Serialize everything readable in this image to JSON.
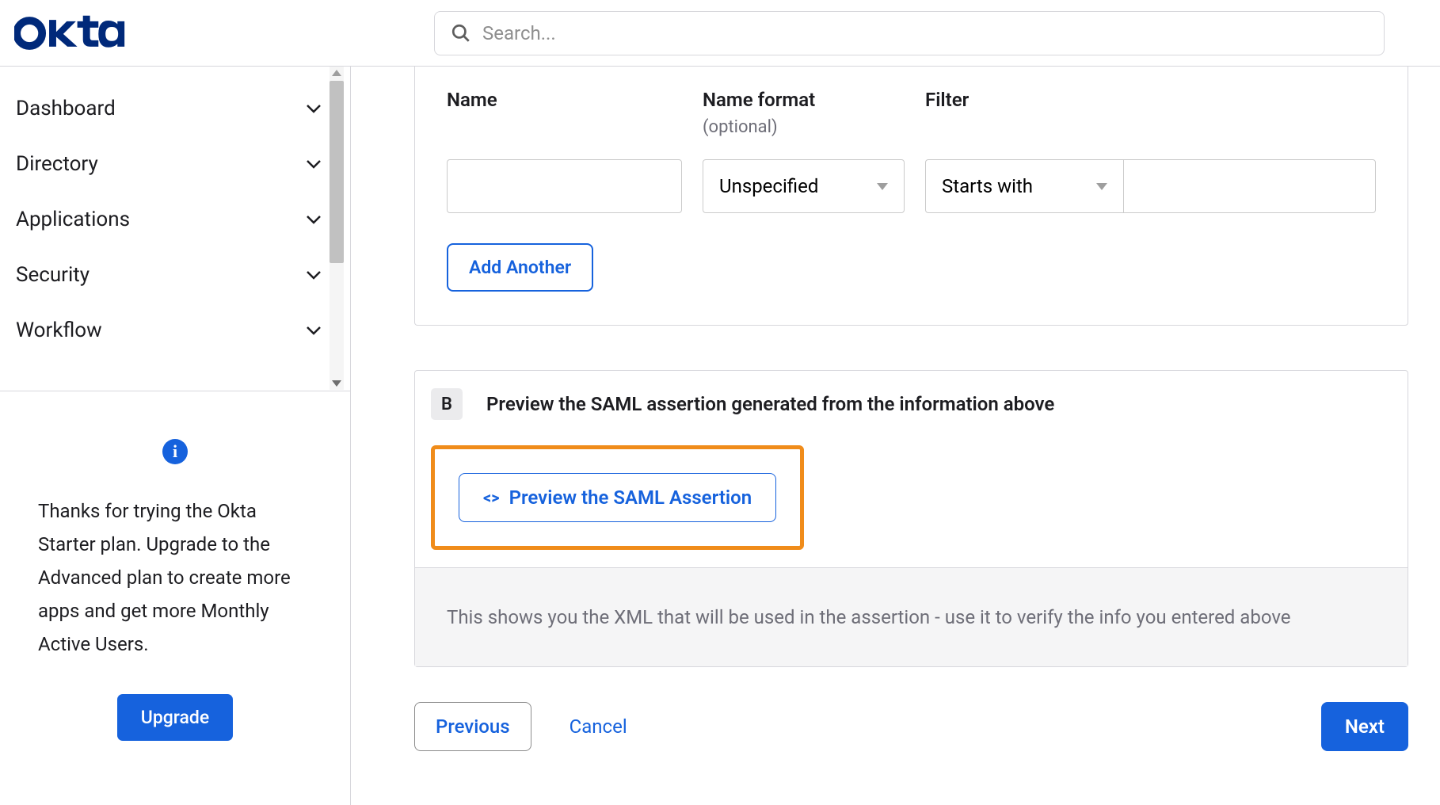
{
  "header": {
    "logo": "okta",
    "search_placeholder": "Search..."
  },
  "sidebar": {
    "items": [
      {
        "label": "Dashboard"
      },
      {
        "label": "Directory"
      },
      {
        "label": "Applications"
      },
      {
        "label": "Security"
      },
      {
        "label": "Workflow"
      }
    ],
    "upgrade_panel": {
      "text": "Thanks for trying the Okta Starter plan. Upgrade to the Advanced plan to create more apps and get more Monthly Active Users.",
      "button": "Upgrade"
    }
  },
  "form": {
    "columns": {
      "name": "Name",
      "name_format": "Name format",
      "name_format_optional": "(optional)",
      "filter": "Filter"
    },
    "row": {
      "name_value": "",
      "name_format_value": "Unspecified",
      "filter_type": "Starts with",
      "filter_value": ""
    },
    "add_another": "Add Another"
  },
  "section_b": {
    "badge": "B",
    "title": "Preview the SAML assertion generated from the information above",
    "preview_button": "Preview the SAML Assertion",
    "description": "This shows you the XML that will be used in the assertion - use it to verify the info you entered above"
  },
  "wizard": {
    "previous": "Previous",
    "cancel": "Cancel",
    "next": "Next"
  }
}
